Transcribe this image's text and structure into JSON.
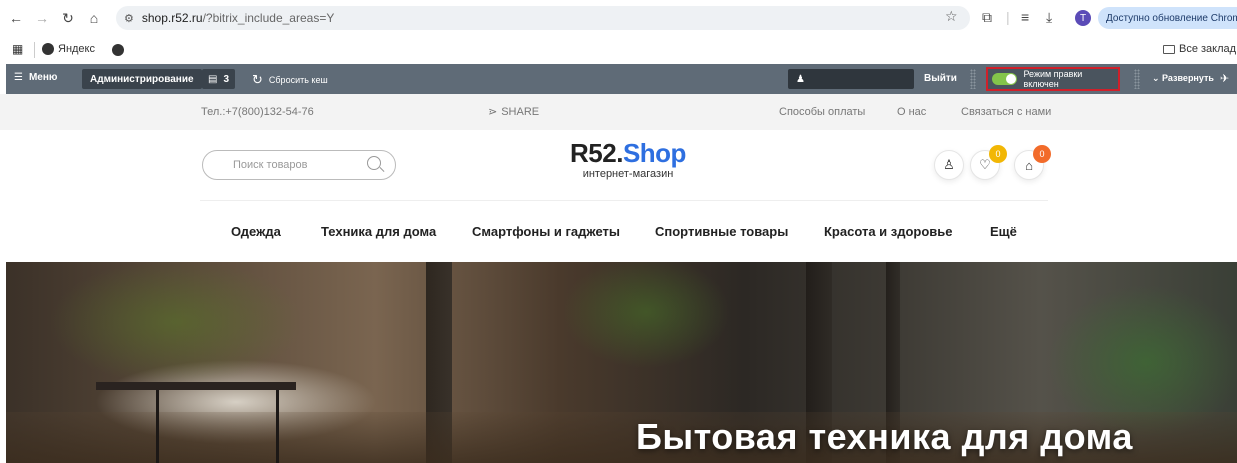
{
  "browser": {
    "url_host": "shop.r52.ru",
    "url_path": "/?bitrix_include_areas=Y",
    "profile_initial": "T",
    "update_label": "Доступно обновление Chrome",
    "bookmarks": [
      {
        "label": "Яндекс"
      }
    ],
    "all_bookmarks_label": "Все заклад"
  },
  "admin_panel": {
    "menu_label": "Меню",
    "admin_label": "Администрирование",
    "notifications_count": "3",
    "clear_cache_label": "Сбросить кеш",
    "logout_label": "Выйти",
    "edit_mode_label": "Режим правки включен",
    "expand_label": "Развернуть"
  },
  "topbar": {
    "phone": "Тел.:+7(800)132-54-76",
    "share": "SHARE",
    "links": [
      "Способы оплаты",
      "О нас",
      "Связаться с нами"
    ]
  },
  "header": {
    "search_placeholder": "Поиск товаров",
    "logo_r": "R52.",
    "logo_s": "Shop",
    "logo_sub": "интернет-магазин",
    "favorites_count": "0",
    "cart_count": "0",
    "colors": {
      "brand_blue": "#2e6fe0",
      "fav_badge": "#f2b705",
      "cart_badge": "#f26b2a"
    }
  },
  "nav": {
    "items": [
      "Одежда",
      "Техника для дома",
      "Смартфоны и гаджеты",
      "Спортивные товары",
      "Красота и здоровье",
      "Ещё"
    ]
  },
  "hero": {
    "title": "Бытовая техника для дома"
  }
}
